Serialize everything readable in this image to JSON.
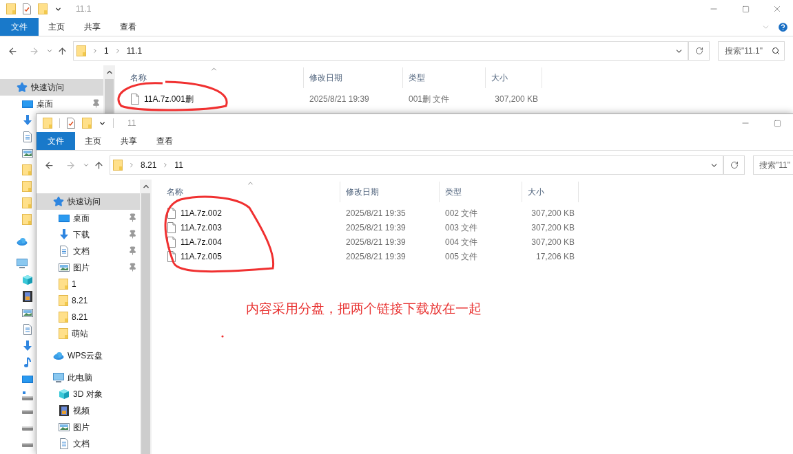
{
  "windows": [
    {
      "title": "11.1",
      "close_button": true,
      "help_button": true,
      "ribbon_tabs": [
        {
          "label": "文件",
          "selected": true
        },
        {
          "label": "主页",
          "selected": false
        },
        {
          "label": "共享",
          "selected": false
        },
        {
          "label": "查看",
          "selected": false
        }
      ],
      "path": [
        "1",
        "11.1"
      ],
      "search": {
        "placeholder": "搜索\"11.1\""
      },
      "sidebar": [
        {
          "label": "快速访问",
          "kind": "star",
          "selected": true,
          "children": [
            {
              "label": "桌面",
              "kind": "desktop",
              "pinned": true,
              "selected": false
            },
            {
              "kind": "download",
              "pinned": false,
              "selected": false
            },
            {
              "kind": "doc",
              "pinned": false,
              "selected": false
            },
            {
              "kind": "picture",
              "pinned": false,
              "selected": false
            },
            {
              "kind": "folder",
              "pinned": false,
              "selected": false
            },
            {
              "kind": "folder",
              "pinned": false,
              "selected": false
            },
            {
              "kind": "folder",
              "pinned": false,
              "selected": false
            },
            {
              "kind": "folder",
              "pinned": false,
              "selected": false
            }
          ]
        },
        {
          "kind": "cloud",
          "selected": false
        },
        {
          "kind": "pc",
          "selected": false,
          "children": [
            {
              "kind": "cube",
              "selected": false
            },
            {
              "kind": "video",
              "selected": false
            },
            {
              "kind": "picture",
              "selected": false
            },
            {
              "kind": "doc",
              "selected": false
            },
            {
              "kind": "download",
              "selected": false
            },
            {
              "kind": "music",
              "selected": false
            },
            {
              "kind": "desktop",
              "selected": false
            },
            {
              "kind": "sysdrive",
              "selected": false
            },
            {
              "kind": "drive",
              "selected": false
            },
            {
              "kind": "drive",
              "selected": false
            },
            {
              "kind": "drive",
              "selected": false
            }
          ]
        }
      ],
      "columns": [
        "名称",
        "修改日期",
        "类型",
        "大小"
      ],
      "rows": [
        {
          "name": "11A.7z.001删",
          "date": "2025/8/21 19:39",
          "type": "001删 文件",
          "size": "307,200 KB"
        }
      ]
    },
    {
      "title": "11",
      "close_button": false,
      "help_button": false,
      "ribbon_tabs": [
        {
          "label": "文件",
          "selected": true
        },
        {
          "label": "主页",
          "selected": false
        },
        {
          "label": "共享",
          "selected": false
        },
        {
          "label": "查看",
          "selected": false
        }
      ],
      "path": [
        "8.21",
        "11"
      ],
      "search": {
        "placeholder": "搜索\"11\""
      },
      "sidebar": [
        {
          "label": "快速访问",
          "kind": "star",
          "selected": true,
          "children": [
            {
              "label": "桌面",
              "kind": "desktop",
              "pinned": true,
              "selected": false
            },
            {
              "label": "下载",
              "kind": "download",
              "pinned": true,
              "selected": false
            },
            {
              "label": "文档",
              "kind": "doc",
              "pinned": true,
              "selected": false
            },
            {
              "label": "图片",
              "kind": "picture",
              "pinned": true,
              "selected": false
            },
            {
              "label": "1",
              "kind": "folder",
              "pinned": false,
              "selected": false
            },
            {
              "label": "8.21",
              "kind": "folder",
              "pinned": false,
              "selected": false
            },
            {
              "label": "8.21",
              "kind": "folder",
              "pinned": false,
              "selected": false
            },
            {
              "label": "萌站",
              "kind": "folder",
              "pinned": false,
              "selected": false
            }
          ]
        },
        {
          "label": "WPS云盘",
          "kind": "cloud",
          "selected": false
        },
        {
          "label": "此电脑",
          "kind": "pc",
          "selected": false,
          "children": [
            {
              "label": "3D 对象",
              "kind": "cube",
              "selected": false
            },
            {
              "label": "视频",
              "kind": "video",
              "selected": false
            },
            {
              "label": "图片",
              "kind": "picture",
              "selected": false
            },
            {
              "label": "文档",
              "kind": "doc",
              "selected": false
            }
          ]
        }
      ],
      "columns": [
        "名称",
        "修改日期",
        "类型",
        "大小"
      ],
      "rows": [
        {
          "name": "11A.7z.002",
          "date": "2025/8/21 19:35",
          "type": "002 文件",
          "size": "307,200 KB"
        },
        {
          "name": "11A.7z.003",
          "date": "2025/8/21 19:39",
          "type": "003 文件",
          "size": "307,200 KB"
        },
        {
          "name": "11A.7z.004",
          "date": "2025/8/21 19:39",
          "type": "004 文件",
          "size": "307,200 KB"
        },
        {
          "name": "11A.7z.005",
          "date": "2025/8/21 19:39",
          "type": "005 文件",
          "size": "17,206 KB"
        }
      ]
    }
  ],
  "annotation": {
    "text": "内容采用分盘，把两个链接下载放在一起"
  }
}
